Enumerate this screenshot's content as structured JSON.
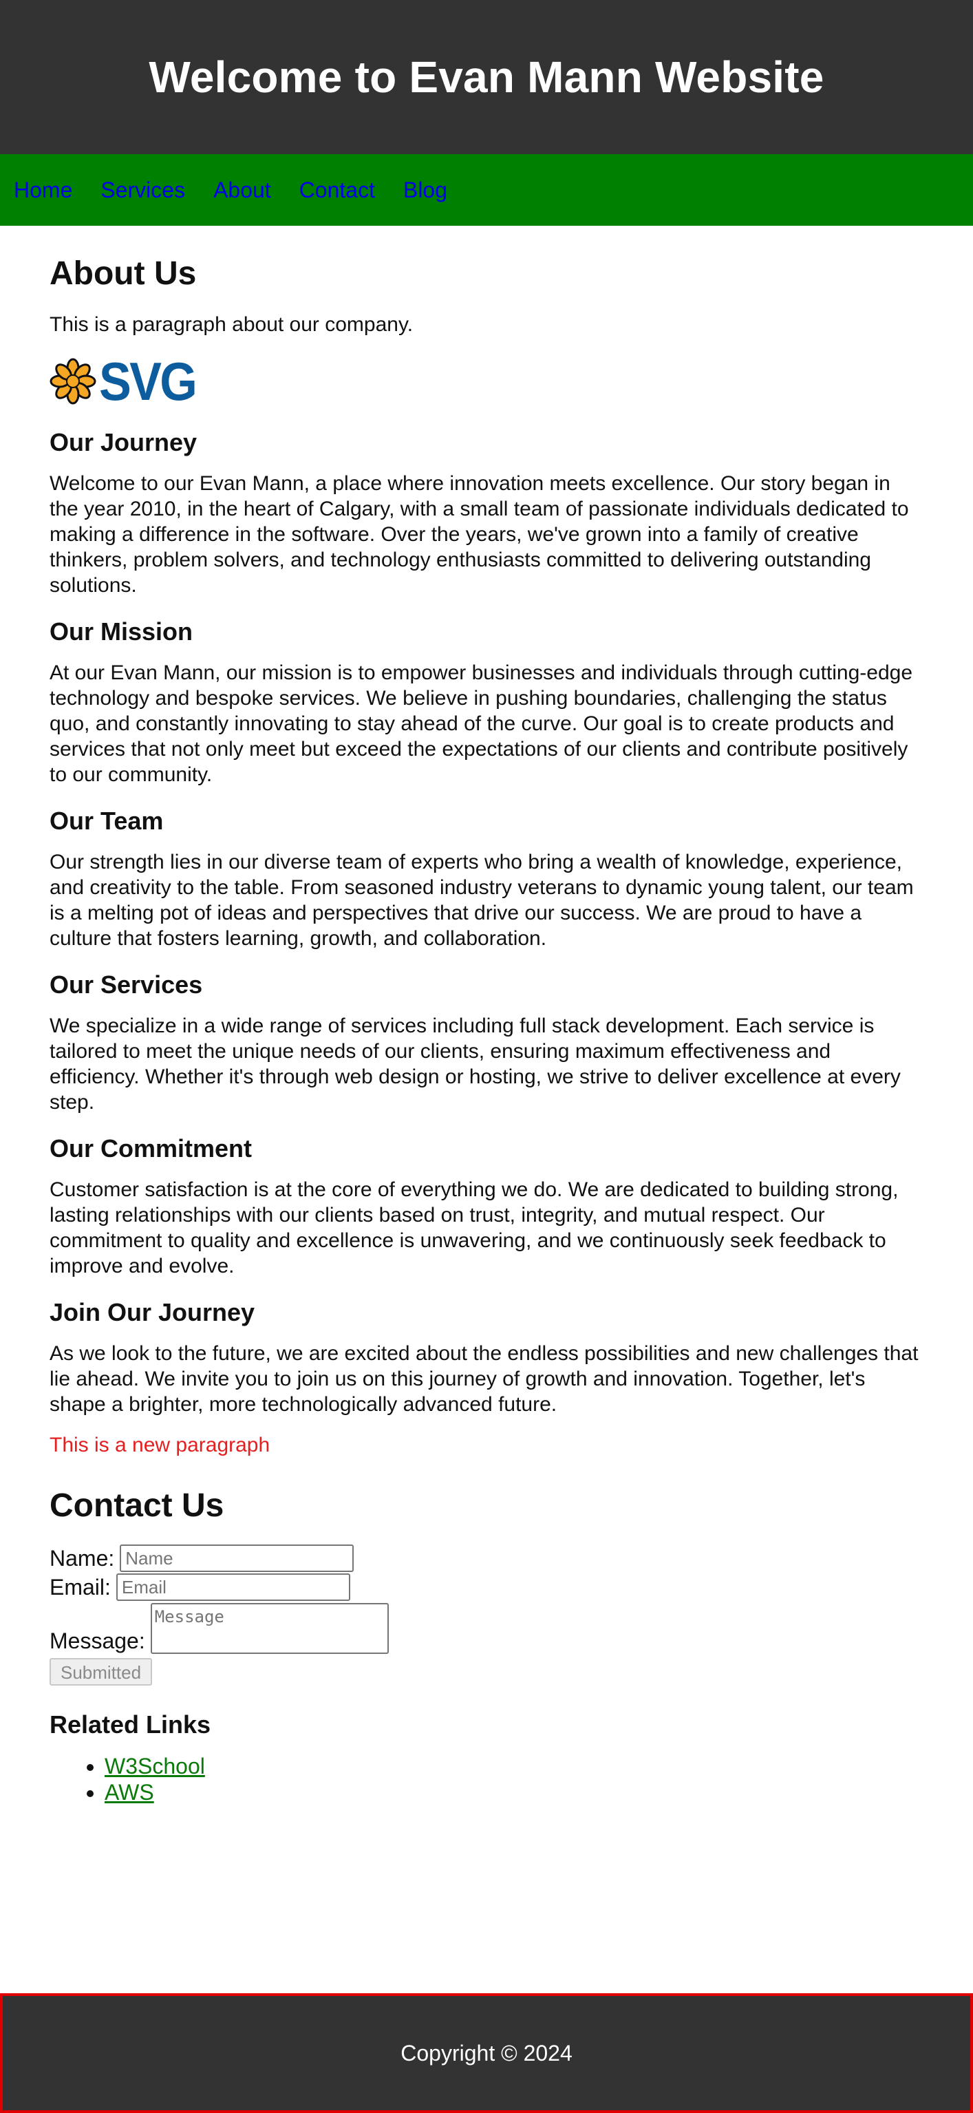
{
  "header": {
    "title": "Welcome to Evan Mann Website"
  },
  "nav": {
    "items": [
      {
        "label": "Home"
      },
      {
        "label": "Services"
      },
      {
        "label": "About"
      },
      {
        "label": "Contact"
      },
      {
        "label": "Blog"
      }
    ]
  },
  "about": {
    "title": "About Us",
    "intro": "This is a paragraph about our company.",
    "logo_text": "SVG"
  },
  "sections": [
    {
      "heading": "Our Journey",
      "body": "Welcome to our Evan Mann, a place where innovation meets excellence. Our story began in the year 2010, in the heart of Calgary, with a small team of passionate individuals dedicated to making a difference in the software. Over the years, we've grown into a family of creative thinkers, problem solvers, and technology enthusiasts committed to delivering outstanding solutions."
    },
    {
      "heading": "Our Mission",
      "body": "At our Evan Mann, our mission is to empower businesses and individuals through cutting-edge technology and bespoke services. We believe in pushing boundaries, challenging the status quo, and constantly innovating to stay ahead of the curve. Our goal is to create products and services that not only meet but exceed the expectations of our clients and contribute positively to our community."
    },
    {
      "heading": "Our Team",
      "body": "Our strength lies in our diverse team of experts who bring a wealth of knowledge, experience, and creativity to the table. From seasoned industry veterans to dynamic young talent, our team is a melting pot of ideas and perspectives that drive our success. We are proud to have a culture that fosters learning, growth, and collaboration."
    },
    {
      "heading": "Our Services",
      "body": "We specialize in a wide range of services including full stack development. Each service is tailored to meet the unique needs of our clients, ensuring maximum effectiveness and efficiency. Whether it's through web design or hosting, we strive to deliver excellence at every step."
    },
    {
      "heading": "Our Commitment",
      "body": "Customer satisfaction is at the core of everything we do. We are dedicated to building strong, lasting relationships with our clients based on trust, integrity, and mutual respect. Our commitment to quality and excellence is unwavering, and we continuously seek feedback to improve and evolve."
    },
    {
      "heading": "Join Our Journey",
      "body": "As we look to the future, we are excited about the endless possibilities and new challenges that lie ahead. We invite you to join us on this journey of growth and innovation. Together, let's shape a brighter, more technologically advanced future."
    }
  ],
  "new_paragraph": "This is a new paragraph",
  "contact": {
    "title": "Contact Us",
    "name_label": "Name:",
    "name_placeholder": "Name",
    "email_label": "Email:",
    "email_placeholder": "Email",
    "message_label": "Message:",
    "message_placeholder": "Message",
    "submit_label": "Submitted"
  },
  "related": {
    "title": "Related Links",
    "links": [
      {
        "label": "W3School"
      },
      {
        "label": "AWS"
      }
    ]
  },
  "footer": {
    "copyright": "Copyright © 2024"
  },
  "colors": {
    "header_bg": "#333333",
    "nav_bg": "#008000",
    "nav_link": "#0000ee",
    "new_paragraph": "#e32020",
    "related_link": "#0a7a0a",
    "footer_border": "#e00000"
  }
}
